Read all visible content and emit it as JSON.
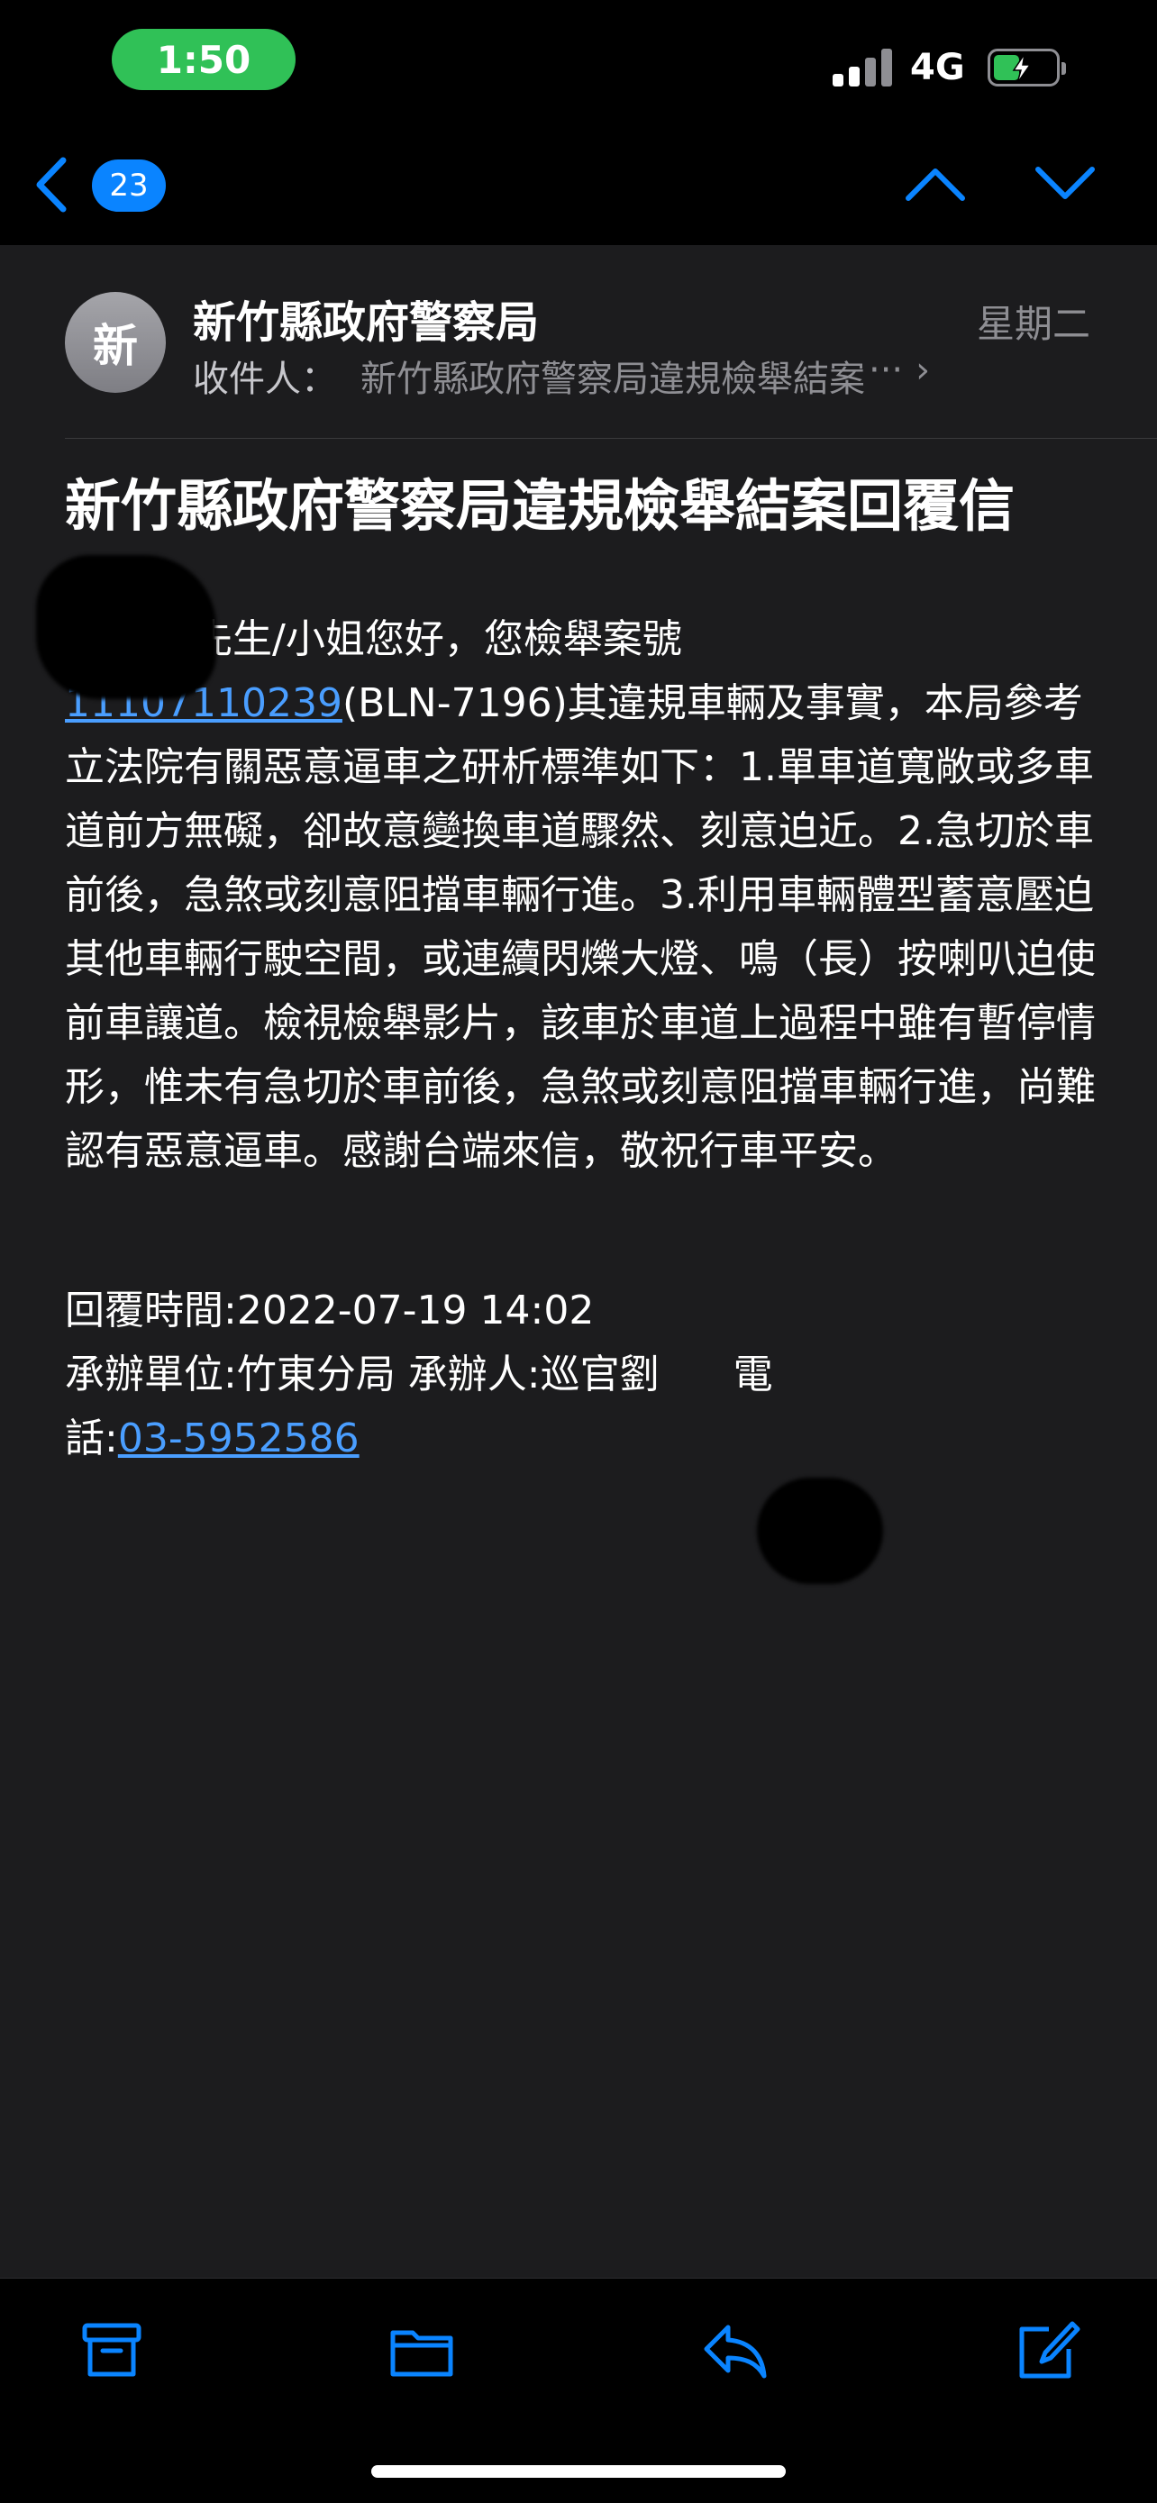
{
  "status_bar": {
    "time": "1:50",
    "network": "4G",
    "colors": {
      "pill": "#30c157",
      "battery": "#30c157"
    },
    "icons": [
      "signal-bars-icon",
      "battery-charging-icon"
    ]
  },
  "nav": {
    "unread_count": "23",
    "icons": [
      "back-chevron-icon",
      "previous-message-icon",
      "next-message-icon"
    ],
    "accent": "#0a84ff"
  },
  "header": {
    "avatar_initial": "新",
    "sender": "新竹縣政府警察局",
    "date": "星期二",
    "to_label": "收件人：",
    "to_value": "新竹縣政府警察局違規檢舉結案",
    "to_ellipsis": "···",
    "to_chevron": "›"
  },
  "email": {
    "subject": "新竹縣政府警察局違規檢舉結案回覆信",
    "greeting": "先生/小姐您好，您檢舉案號",
    "case_number": "11107110239",
    "body_after_case": "(BLN-7196)其違規車輛及事實，本局參考立法院有關惡意逼車之研析標準如下：1.單車道寬敞或多車道前方無礙，卻故意變換車道驟然、刻意迫近。2.急切於車前後，急煞或刻意阻擋車輛行進。3.利用車輛體型蓄意壓迫其他車輛行駛空間，或連續閃爍大燈、鳴（長）按喇叭迫使前車讓道。檢視檢舉影片，該車於車道上過程中雖有暫停情形，惟未有急切於車前後，急煞或刻意阻擋車輛行進，尚難認有惡意逼車。感謝台端來信，敬祝行車平安。",
    "reply_time": "回覆時間:2022-07-19 14:02",
    "unit_line_1": "承辦單位:竹東分局 承辦人:巡官劉",
    "unit_line_2_suffix": "電",
    "phone_label": "話:",
    "phone": "03-5952586",
    "link_color": "#4a9eff"
  },
  "toolbar": {
    "icons": [
      "archive-icon",
      "folder-icon",
      "reply-icon",
      "compose-icon"
    ],
    "color": "#0a84ff"
  }
}
